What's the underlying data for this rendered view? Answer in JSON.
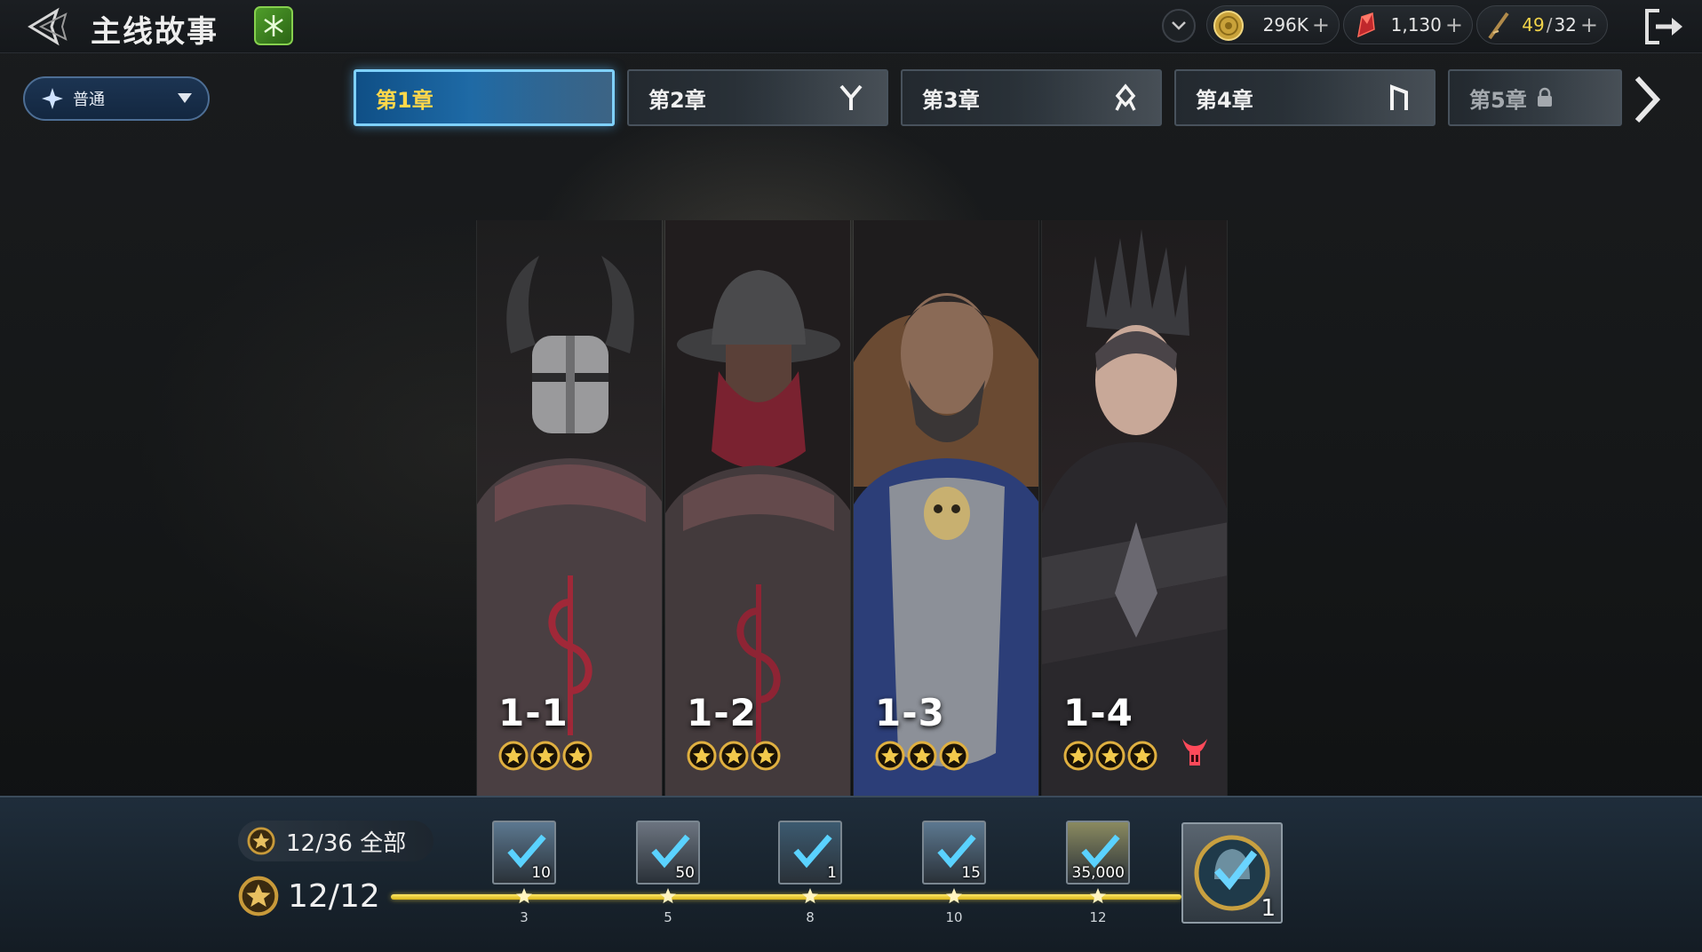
{
  "header": {
    "title": "主线故事",
    "resources": {
      "coins": {
        "value": "296K",
        "plus": "+"
      },
      "gems": {
        "value": "1,130",
        "plus": "+"
      },
      "stamina": {
        "current": "49",
        "separator": "/",
        "max": "32",
        "plus": "+"
      }
    }
  },
  "difficulty": {
    "label": "普通"
  },
  "chapters": [
    {
      "label": "第1章",
      "state": "active"
    },
    {
      "label": "第2章",
      "state": "unlocked",
      "rune": "Y"
    },
    {
      "label": "第3章",
      "state": "unlocked",
      "rune": "ᛟ"
    },
    {
      "label": "第4章",
      "state": "unlocked",
      "rune": "ᚢ"
    },
    {
      "label": "第5章",
      "state": "locked"
    }
  ],
  "stages": [
    {
      "number": "1-1",
      "stars": 3
    },
    {
      "number": "1-2",
      "stars": 3
    },
    {
      "number": "1-3",
      "stars": 3
    },
    {
      "number": "1-4",
      "stars": 3,
      "boss": true
    }
  ],
  "progress": {
    "total_text": "12/36 全部",
    "chapter_text": "12/12",
    "current": 12,
    "max": 12,
    "milestones": [
      {
        "stars": "3",
        "reward_qty": "10",
        "claimed": true
      },
      {
        "stars": "5",
        "reward_qty": "50",
        "claimed": true
      },
      {
        "stars": "8",
        "reward_qty": "1",
        "claimed": true
      },
      {
        "stars": "10",
        "reward_qty": "15",
        "claimed": true
      },
      {
        "stars": "12",
        "reward_qty": "35,000",
        "claimed": true
      }
    ],
    "final_reward_qty": "1"
  },
  "colors": {
    "accent_blue": "#7fd1ff",
    "active_tab_text": "#ffd84a",
    "progress_gold": "#ffe866",
    "boss_red": "#c8151a"
  }
}
